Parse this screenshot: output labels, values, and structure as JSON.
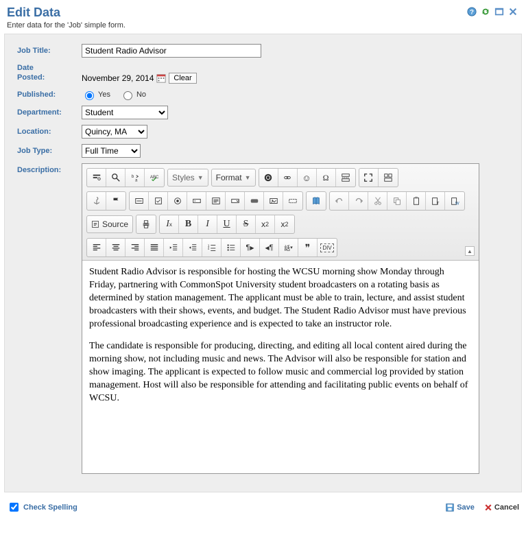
{
  "header": {
    "title": "Edit Data",
    "subtitle": "Enter data for the 'Job' simple form."
  },
  "labels": {
    "job_title": "Job Title:",
    "date_posted": "Date Posted:",
    "published": "Published:",
    "department": "Department:",
    "location": "Location:",
    "job_type": "Job Type:",
    "description": "Description:"
  },
  "form": {
    "job_title": "Student Radio Advisor",
    "date_posted": "November 29, 2014",
    "clear_label": "Clear",
    "published_yes": "Yes",
    "published_no": "No",
    "department": "Student",
    "location": "Quincy, MA",
    "job_type": "Full Time"
  },
  "toolbar": {
    "styles": "Styles",
    "format": "Format",
    "source": "Source",
    "I": "I",
    "B": "B",
    "U": "U",
    "S": "S",
    "x2s": "x",
    "x2p": "x",
    "two": "2",
    "quote": "❞",
    "div": "DIV",
    "abc": "abc",
    "omega": "Ω",
    "smile": "☺"
  },
  "description": {
    "p1": "Student Radio Advisor is responsible for hosting the WCSU morning show Monday through Friday, partnering with CommonSpot University student broadcasters on a rotating basis as determined by station management. The applicant must be able to train, lecture, and assist student broadcasters with their shows, events, and budget. The Student Radio Advisor must have previous professional broadcasting experience and is expected to take an instructor role.",
    "p2": "The candidate is responsible for producing, directing, and editing all local content aired during the morning show, not including music and news. The Advisor will also be responsible for station and show imaging. The applicant is expected to follow music and commercial log provided by station management. Host will also be responsible for attending and facilitating public events on behalf of WCSU."
  },
  "footer": {
    "check_spelling": "Check Spelling",
    "save": "Save",
    "cancel": "Cancel"
  }
}
